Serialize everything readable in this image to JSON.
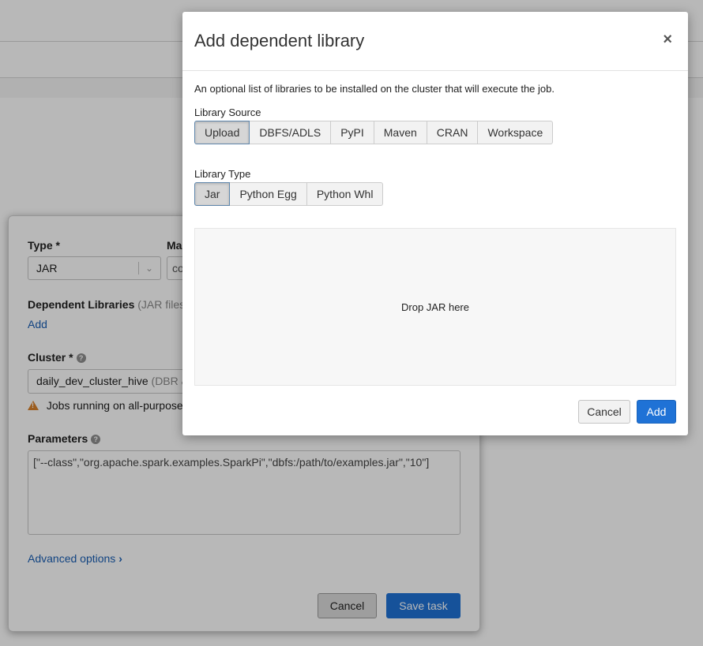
{
  "task_form": {
    "type_label": "Type *",
    "type_value": "JAR",
    "main_class_label": "Ma",
    "main_class_value": "co",
    "dependent_libraries_label": "Dependent Libraries",
    "dependent_libraries_hint": "(JAR files",
    "add_link": "Add",
    "cluster_label": "Cluster *",
    "cluster_value": "daily_dev_cluster_hive",
    "cluster_hint": "(DBR &",
    "warning_text": "Jobs running on all-purpose",
    "parameters_label": "Parameters",
    "parameters_value": "[\"--class\",\"org.apache.spark.examples.SparkPi\",\"dbfs:/path/to/examples.jar\",\"10\"]",
    "advanced_options": "Advanced options",
    "cancel_label": "Cancel",
    "save_label": "Save task"
  },
  "modal": {
    "title": "Add dependent library",
    "close_glyph": "×",
    "description": "An optional list of libraries to be installed on the cluster that will execute the job.",
    "library_source_label": "Library Source",
    "library_sources": [
      {
        "label": "Upload",
        "active": true
      },
      {
        "label": "DBFS/ADLS",
        "active": false
      },
      {
        "label": "PyPI",
        "active": false
      },
      {
        "label": "Maven",
        "active": false
      },
      {
        "label": "CRAN",
        "active": false
      },
      {
        "label": "Workspace",
        "active": false
      }
    ],
    "library_type_label": "Library Type",
    "library_types": [
      {
        "label": "Jar",
        "active": true
      },
      {
        "label": "Python Egg",
        "active": false
      },
      {
        "label": "Python Whl",
        "active": false
      }
    ],
    "drop_zone_text": "Drop JAR here",
    "cancel_label": "Cancel",
    "add_label": "Add"
  },
  "colors": {
    "primary": "#1f72d6",
    "link": "#1a5fb4",
    "warning": "#d9822b"
  }
}
